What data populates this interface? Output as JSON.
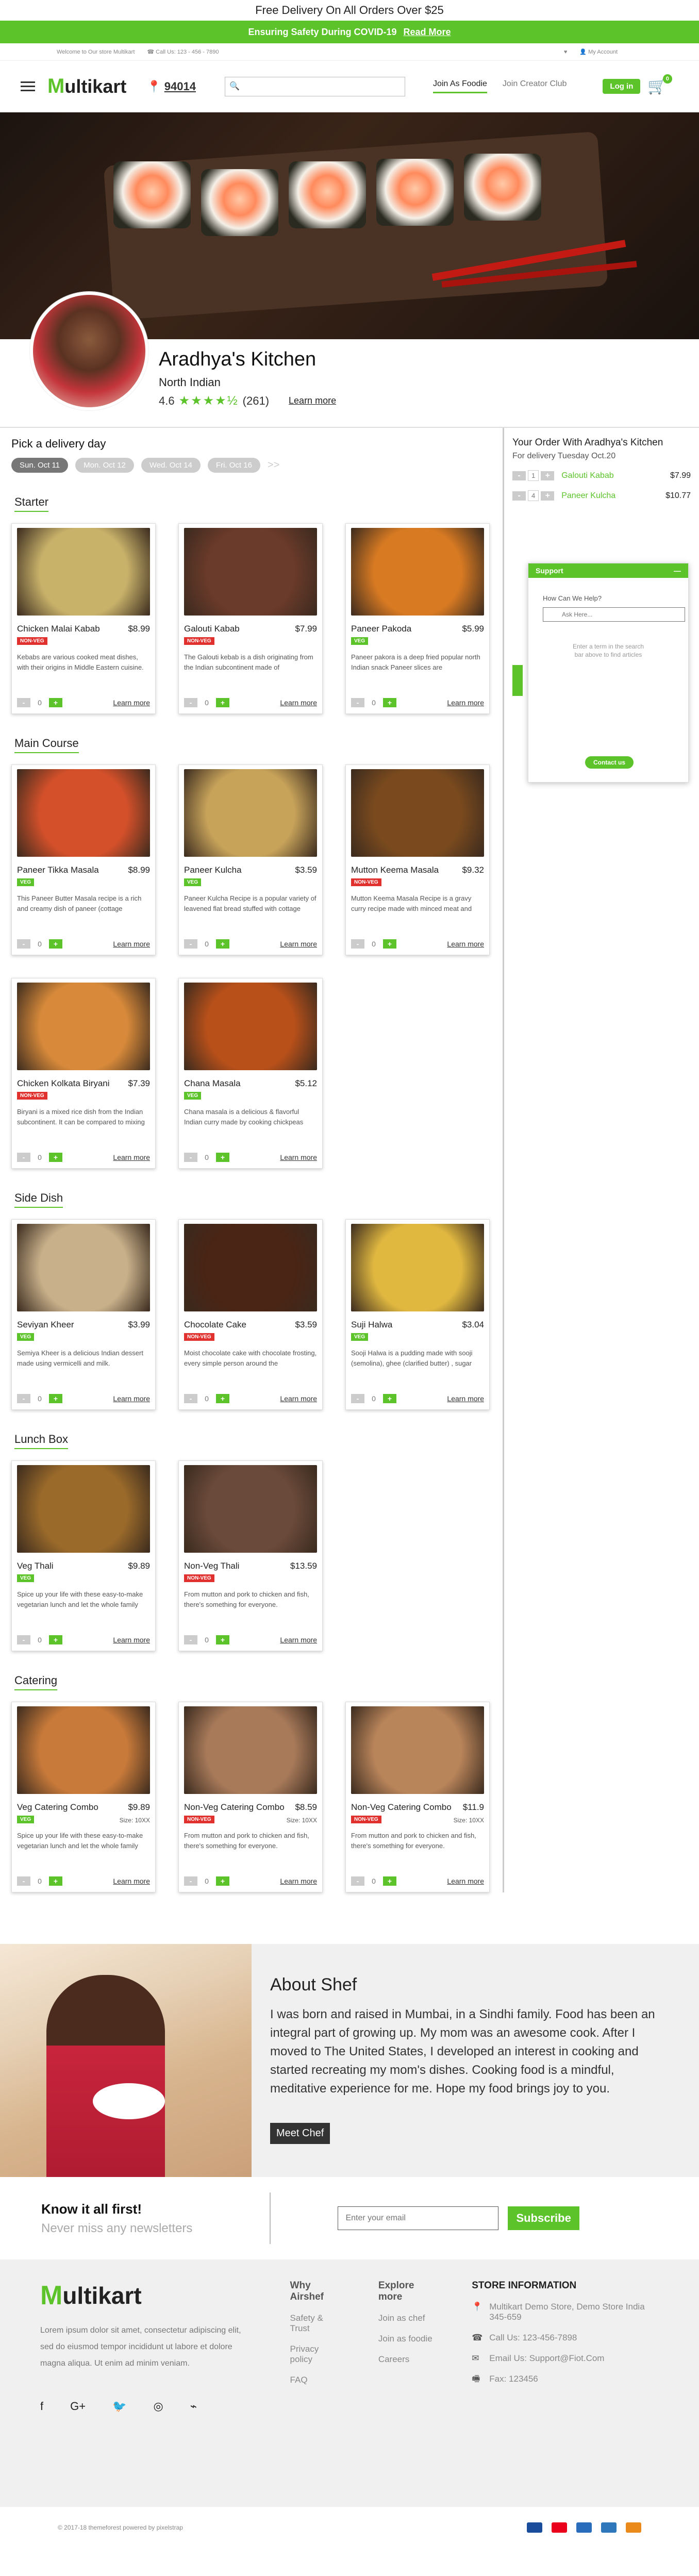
{
  "topbar": {
    "promo": "Free Delivery On All Orders Over $25"
  },
  "covid": {
    "text": "Ensuring Safety During COVID-19",
    "link": "Read More"
  },
  "info": {
    "welcome": "Welcome to Our store Multikart",
    "phone": "Call Us: 123 - 456 - 7890",
    "account": "My Account"
  },
  "header": {
    "logo_m": "M",
    "logo_rest": "ultikart",
    "zip": "94014",
    "search_placeholder": "",
    "nav": [
      "Join As Foodie",
      "Join Creator Club"
    ],
    "login": "Log in",
    "cart_count": "0"
  },
  "kitchen": {
    "name": "Aradhya's Kitchen",
    "cuisine": "North Indian",
    "rating": "4.6",
    "reviews": "(261)",
    "learn": "Learn more"
  },
  "delivery": {
    "title": "Pick a delivery day",
    "days": [
      "Sun. Oct 11",
      "Mon. Oct 12",
      "Wed. Oct 14",
      "Fri. Oct 16"
    ],
    "more": ">>"
  },
  "sections": [
    {
      "title": "Starter",
      "items": [
        {
          "name": "Chicken Malai Kabab",
          "price": "$8.99",
          "tag": "NON-VEG",
          "veg": false,
          "desc": "Kebabs are various cooked meat dishes, with their origins in Middle Eastern cuisine.",
          "img": "#c8b26a"
        },
        {
          "name": "Galouti Kabab",
          "price": "$7.99",
          "tag": "NON-VEG",
          "veg": false,
          "desc": "The Galouti kebab is a dish originating from the Indian subcontinent made of",
          "img": "#6a3a2a"
        },
        {
          "name": "Paneer Pakoda",
          "price": "$5.99",
          "tag": "VEG",
          "veg": true,
          "desc": "Paneer pakora is a deep fried popular north Indian snack Paneer slices are",
          "img": "#d87a22"
        }
      ]
    },
    {
      "title": "Main  Course",
      "items": [
        {
          "name": "Paneer Tikka Masala",
          "price": "$8.99",
          "tag": "VEG",
          "veg": true,
          "desc": "This Paneer Butter Masala recipe is a rich and creamy dish of paneer (cottage",
          "img": "#d4502a"
        },
        {
          "name": "Paneer Kulcha",
          "price": "$3.59",
          "tag": "VEG",
          "veg": true,
          "desc": "Paneer Kulcha Recipe is a popular variety of leavened flat bread stuffed with cottage",
          "img": "#c7a35a"
        },
        {
          "name": "Mutton Keema Masala",
          "price": "$9.32",
          "tag": "NON-VEG",
          "veg": false,
          "desc": "Mutton Keema Masala Recipe is a gravy curry recipe made with minced meat and",
          "img": "#7a4a1e"
        },
        {
          "name": "Chicken Kolkata Biryani",
          "price": "$7.39",
          "tag": "NON-VEG",
          "veg": false,
          "desc": "Biryani is a mixed rice dish from the Indian subcontinent. It can be compared to mixing",
          "img": "#d88a3a"
        },
        {
          "name": "Chana Masala",
          "price": "$5.12",
          "tag": "VEG",
          "veg": true,
          "desc": "Chana masala is a delicious & flavorful Indian curry made by cooking chickpeas",
          "img": "#b8501a"
        }
      ]
    },
    {
      "title": "Side Dish",
      "items": [
        {
          "name": "Seviyan Kheer",
          "price": "$3.99",
          "tag": "VEG",
          "veg": true,
          "desc": "Semiya Kheer is a delicious Indian dessert made using vermicelli and milk.",
          "img": "#c8b08a"
        },
        {
          "name": "Chocolate Cake",
          "price": "$3.59",
          "tag": "NON-VEG",
          "veg": false,
          "desc": "Moist chocolate cake with chocolate frosting, every simple person around the",
          "img": "#4a2414"
        },
        {
          "name": "Suji Halwa",
          "price": "$3.04",
          "tag": "VEG",
          "veg": true,
          "desc": "Sooji Halwa is a pudding made with sooji (semolina), ghee (clarified butter) , sugar",
          "img": "#e0b840"
        }
      ]
    },
    {
      "title": "Lunch Box",
      "items": [
        {
          "name": "Veg Thali",
          "price": "$9.89",
          "tag": "VEG",
          "veg": true,
          "desc": "Spice up your life with these easy-to-make vegetarian lunch and let the whole family",
          "img": "#9a6a2a"
        },
        {
          "name": "Non-Veg Thali",
          "price": "$13.59",
          "tag": "NON-VEG",
          "veg": false,
          "desc": "From mutton and pork to chicken and fish, there's something for everyone.",
          "img": "#6a4a3a"
        }
      ]
    },
    {
      "title": "Catering",
      "items": [
        {
          "name": "Veg Catering Combo",
          "price": "$9.89",
          "tag": "VEG",
          "veg": true,
          "size": "Size: 10XX",
          "desc": "Spice up your life with these easy-to-make vegetarian lunch and let the whole family",
          "img": "#c87a3a"
        },
        {
          "name": "Non-Veg Catering Combo",
          "price": "$8.59",
          "tag": "NON-VEG",
          "veg": false,
          "size": "Size: 10XX",
          "desc": "From mutton and pork to chicken and fish, there's something for everyone.",
          "img": "#a87a5a"
        },
        {
          "name": "Non-Veg Catering Combo",
          "price": "$11.9",
          "tag": "NON-VEG",
          "veg": false,
          "size": "Size: 10XX",
          "desc": "From mutton and pork to chicken and fish, there's something for everyone.",
          "img": "#b8845a"
        }
      ]
    }
  ],
  "card_ui": {
    "minus": "-",
    "plus": "+",
    "qty": "0",
    "learn": "Learn more"
  },
  "order": {
    "title": "Your Order With Aradhya's Kitchen",
    "sub": "For delivery Tuesday Oct.20",
    "items": [
      {
        "qty": "1",
        "name": "Galouti Kabab",
        "price": "$7.99"
      },
      {
        "qty": "4",
        "name": "Paneer Kulcha",
        "price": "$10.77"
      }
    ]
  },
  "support": {
    "title": "Support",
    "question": "How Can We Help?",
    "placeholder": "Ask Here...",
    "hint": "Enter a term in the search bar above to find articles",
    "contact": "Contact us"
  },
  "about": {
    "title": "About Shef",
    "text": "I was born and raised in Mumbai, in a Sindhi family. Food has been an integral part of growing up. My mom was an awesome cook. After I moved to The United States, I developed an interest in cooking and started recreating my mom's dishes. Cooking food is a mindful, meditative experience for me. Hope my food brings joy to you.",
    "button": "Meet Chef"
  },
  "newsletter": {
    "title": "Know it all first!",
    "sub": "Never miss any newsletters",
    "placeholder": "Enter your email",
    "button": "Subscribe"
  },
  "footer": {
    "text": "Lorem ipsum dolor sit amet, consectetur adipiscing elit, sed do eiusmod tempor incididunt ut labore et dolore magna aliqua. Ut enim ad minim veniam.",
    "col1": {
      "title": "Why Airshef",
      "links": [
        "Safety & Trust",
        "Privacy policy",
        "FAQ"
      ]
    },
    "col2": {
      "title": "Explore more",
      "links": [
        "Join as chef",
        "Join as foodie",
        "Careers"
      ]
    },
    "store": {
      "title": "STORE INFORMATION",
      "address": "Multikart Demo Store, Demo Store India 345-659",
      "phone": "Call Us: 123-456-7898",
      "email": "Email Us: Support@Fiot.Com",
      "fax": "Fax: 123456"
    },
    "copyright": "© 2017-18 themeforest powered by pixelstrap"
  },
  "colors": {
    "accent": "#5cc32a",
    "nonveg": "#e0312e"
  }
}
